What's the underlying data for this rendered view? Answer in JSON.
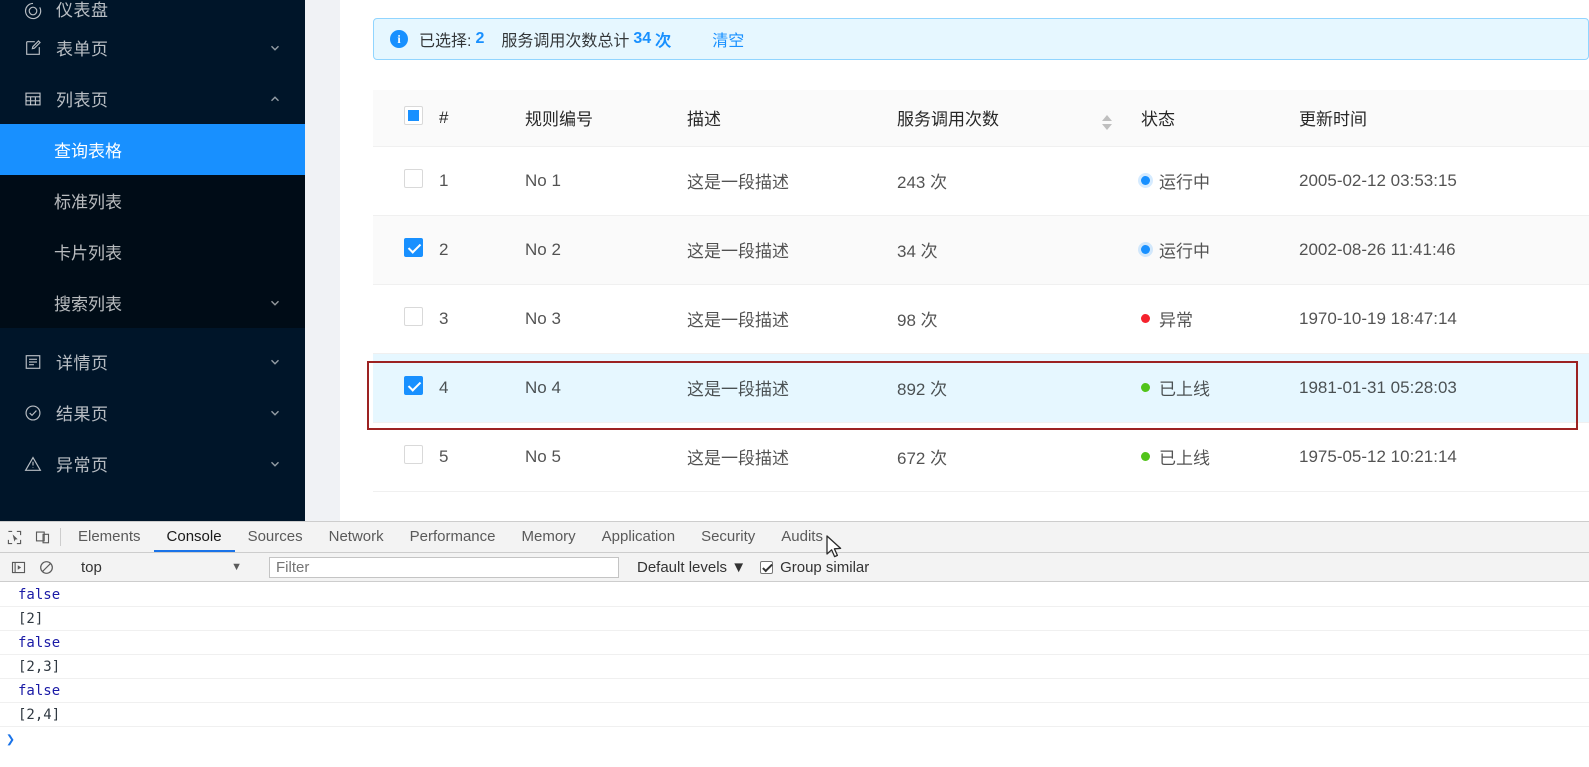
{
  "sidebar": {
    "items": [
      {
        "label": "仪表盘",
        "icon": "dashboard-icon",
        "arrow": "",
        "cut": true
      },
      {
        "label": "表单页",
        "icon": "form-icon",
        "arrow": "chevron-down-icon"
      },
      {
        "label": "列表页",
        "icon": "table-icon",
        "arrow": "chevron-up-icon"
      }
    ],
    "submenu": [
      {
        "label": "查询表格",
        "active": true,
        "arrow": ""
      },
      {
        "label": "标准列表",
        "active": false,
        "arrow": ""
      },
      {
        "label": "卡片列表",
        "active": false,
        "arrow": ""
      },
      {
        "label": "搜索列表",
        "active": false,
        "arrow": "chevron-down-icon"
      }
    ],
    "items_after": [
      {
        "label": "详情页",
        "icon": "profile-icon",
        "arrow": "chevron-down-icon"
      },
      {
        "label": "结果页",
        "icon": "check-circle-icon",
        "arrow": "chevron-down-icon"
      },
      {
        "label": "异常页",
        "icon": "warning-icon",
        "arrow": "chevron-down-icon",
        "cut_bottom": true
      }
    ]
  },
  "alert": {
    "icon": "info-circle-icon",
    "selected_prefix": "已选择:",
    "selected_count": "2",
    "total_prefix": "服务调用次数总计",
    "total_count": "34",
    "total_unit": "次",
    "clear_label": "清空"
  },
  "table": {
    "headers": {
      "select_all": "select-all-checkbox",
      "index": "#",
      "rule": "规则编号",
      "desc": "描述",
      "calls": "服务调用次数",
      "status": "状态",
      "time": "更新时间"
    },
    "rows": [
      {
        "checked": false,
        "index": "1",
        "rule": "No 1",
        "desc": "这是一段描述",
        "calls": "243 次",
        "status": "运行中",
        "status_type": "processing",
        "time": "2005-02-12 03:53:15",
        "alt": false,
        "highlight": false
      },
      {
        "checked": true,
        "index": "2",
        "rule": "No 2",
        "desc": "这是一段描述",
        "calls": "34 次",
        "status": "运行中",
        "status_type": "processing",
        "time": "2002-08-26 11:41:46",
        "alt": true,
        "highlight": false
      },
      {
        "checked": false,
        "index": "3",
        "rule": "No 3",
        "desc": "这是一段描述",
        "calls": "98 次",
        "status": "异常",
        "status_type": "error",
        "time": "1970-10-19 18:47:14",
        "alt": false,
        "highlight": false
      },
      {
        "checked": true,
        "index": "4",
        "rule": "No 4",
        "desc": "这是一段描述",
        "calls": "892 次",
        "status": "已上线",
        "status_type": "success",
        "time": "1981-01-31 05:28:03",
        "alt": false,
        "highlight": true
      },
      {
        "checked": false,
        "index": "5",
        "rule": "No 5",
        "desc": "这是一段描述",
        "calls": "672 次",
        "status": "已上线",
        "status_type": "success",
        "time": "1975-05-12 10:21:14",
        "alt": false,
        "highlight": false
      }
    ]
  },
  "devtools": {
    "tools": [
      {
        "name": "inspect-element-icon"
      },
      {
        "name": "device-toolbar-icon"
      }
    ],
    "tabs": [
      {
        "label": "Elements",
        "active": false
      },
      {
        "label": "Console",
        "active": true
      },
      {
        "label": "Sources",
        "active": false
      },
      {
        "label": "Network",
        "active": false
      },
      {
        "label": "Performance",
        "active": false
      },
      {
        "label": "Memory",
        "active": false
      },
      {
        "label": "Application",
        "active": false
      },
      {
        "label": "Security",
        "active": false
      },
      {
        "label": "Audits",
        "active": false
      }
    ],
    "filterbar": {
      "execute_icon": "execute-script-icon",
      "clear_icon": "clear-console-icon",
      "context": "top",
      "context_caret": "▼",
      "filter_placeholder": "Filter",
      "filter_value": "",
      "levels_label": "Default levels",
      "levels_caret": "▼",
      "group_similar_label": "Group similar",
      "group_similar_checked": true
    },
    "console_lines": [
      {
        "text": "false",
        "type": "bool"
      },
      {
        "text": "[2]",
        "type": "value"
      },
      {
        "text": "false",
        "type": "bool"
      },
      {
        "text": "[2,3]",
        "type": "value"
      },
      {
        "text": "false",
        "type": "bool"
      },
      {
        "text": "[2,4]",
        "type": "value"
      }
    ],
    "prompt": "❯"
  },
  "colors": {
    "accent": "#1890ff",
    "sidebar_bg": "#001529",
    "submenu_bg": "#000c17",
    "alert_bg": "#e6f7ff",
    "alert_border": "#91d5ff",
    "highlight_row_bg": "#e6f7ff",
    "highlight_border": "#9c2222",
    "status_processing": "#1890ff",
    "status_error": "#f5222d",
    "status_success": "#52c41a",
    "devtools_tab_active": "#1a73e8"
  }
}
